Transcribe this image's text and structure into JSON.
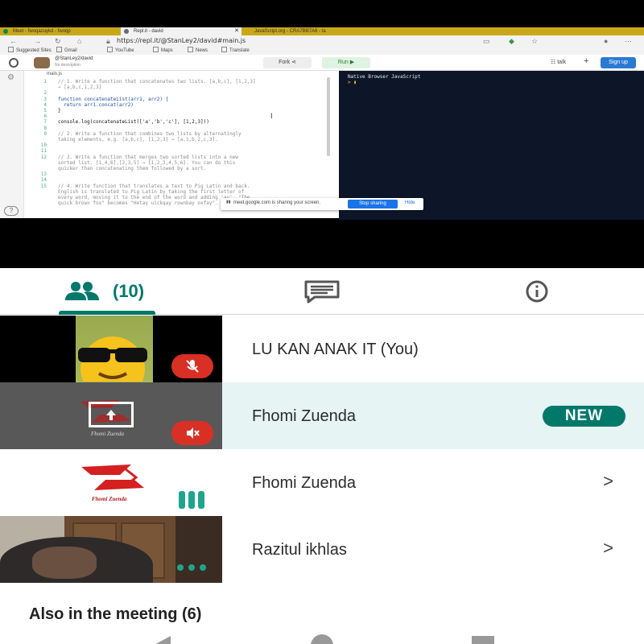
{
  "browser": {
    "tabs": [
      {
        "label": "Meet - fwoqazuykd - fwoqp"
      },
      {
        "label": "Repl.it - david"
      },
      {
        "label": "JavaScript.org - CRA7BB7A8 - ta"
      }
    ],
    "url": "https://repl.it/@StanLey2/david#main.js",
    "bookmarks": [
      "Suggested Sites",
      "Gmail",
      "YouTube",
      "Maps",
      "News",
      "Translate"
    ]
  },
  "repl": {
    "user": "@StanLey2/david",
    "description": "No description",
    "fork_label": "Fork",
    "run_label": "Run",
    "talk_label": "talk",
    "signup_label": "Sign up",
    "file_tab": "main.js",
    "console_title": "Native Browser JavaScript",
    "console_prompt": "> ▮",
    "code_lines": [
      {
        "n": "1",
        "t": "// 1. Write a function that concatenates two lists. [a,b,c], [1,2,3]",
        "c": "cmt"
      },
      {
        "n": "",
        "t": "→ [a,b,c,1,2,3]",
        "c": "cmt"
      },
      {
        "n": "2",
        "t": "",
        "c": "cmt"
      },
      {
        "n": "3",
        "t": "function concatenateList(arr1, arr2) {",
        "c": "kw"
      },
      {
        "n": "4",
        "t": "  return arr1.concat(arr2)",
        "c": "kw"
      },
      {
        "n": "5",
        "t": "}",
        "c": "fn"
      },
      {
        "n": "6",
        "t": "",
        "c": "fn"
      },
      {
        "n": "7",
        "t": "console.log(concatenateList(['a','b','c'], [1,2,3]))",
        "c": "fn"
      },
      {
        "n": "8",
        "t": "",
        "c": "fn"
      },
      {
        "n": "9",
        "t": "// 2. Write a function that combines two lists by alternatingly",
        "c": "cmt"
      },
      {
        "n": "",
        "t": "taking elements, e.g. [a,b,c], [1,2,3] → [a,1,b,2,c,3].",
        "c": "cmt"
      },
      {
        "n": "10",
        "t": "",
        "c": "cmt"
      },
      {
        "n": "11",
        "t": "",
        "c": "cmt"
      },
      {
        "n": "12",
        "t": "// 3. Write a function that merges two sorted lists into a new",
        "c": "cmt"
      },
      {
        "n": "",
        "t": "sorted list. [1,4,6],[2,3,5] → [1,2,3,4,5,6]. You can do this",
        "c": "cmt"
      },
      {
        "n": "",
        "t": "quicker than concatenating them followed by a sort.",
        "c": "cmt"
      },
      {
        "n": "13",
        "t": "",
        "c": "cmt"
      },
      {
        "n": "14",
        "t": "",
        "c": "cmt"
      },
      {
        "n": "15",
        "t": "// 4. Write function that translates a text to Pig Latin and back.",
        "c": "cmt"
      },
      {
        "n": "",
        "t": "English is translated to Pig Latin by taking the first letter of",
        "c": "cmt"
      },
      {
        "n": "",
        "t": "every word, moving it to the end of the word and adding 'ay'. \"The",
        "c": "cmt"
      },
      {
        "n": "",
        "t": "quick brown fox\" becomes \"Hetay uickqay rownbay oxfay\".",
        "c": "cmt"
      }
    ]
  },
  "share_banner": {
    "text": "meet.google.com is sharing your screen.",
    "stop_label": "Stop sharing",
    "hide_label": "Hide"
  },
  "meet_tabs": {
    "people_count": "(10)"
  },
  "participants": [
    {
      "name": "LU KAN ANAK IT (You)",
      "badge": ""
    },
    {
      "name": "Fhomi Zuenda",
      "badge": "NEW"
    },
    {
      "name": "Fhomi Zuenda",
      "badge": ""
    },
    {
      "name": "Razitul ikhlas",
      "badge": ""
    }
  ],
  "logo_text": "Fhomi Zuenda",
  "also_in_meeting": "Also in the meeting (6)",
  "colors": {
    "accent": "#00796b",
    "mute_red": "#d93025",
    "selected_row": "#e6f4f4",
    "console_bg": "#0d1629"
  }
}
